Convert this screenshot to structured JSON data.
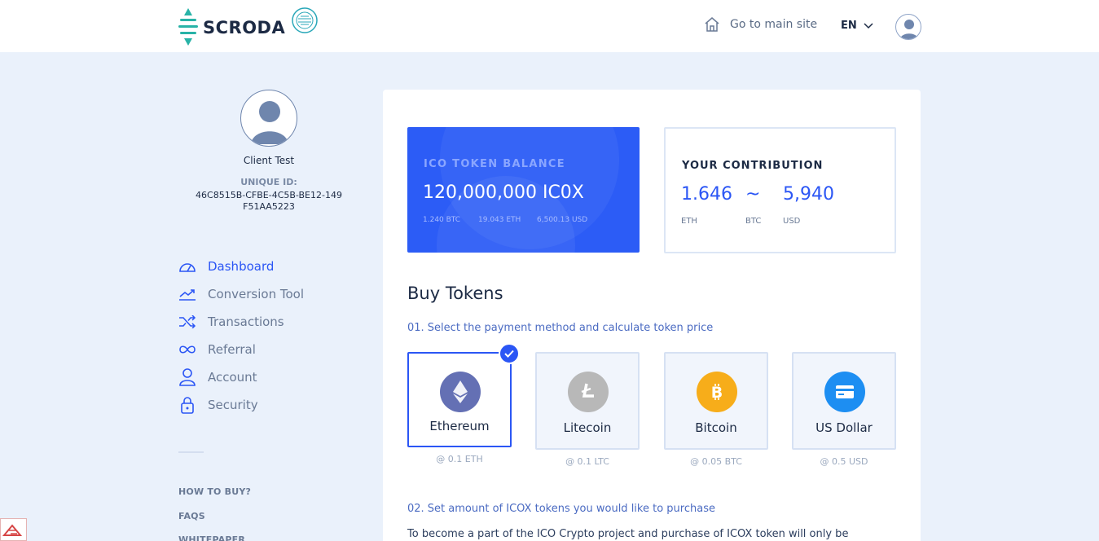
{
  "header": {
    "brand": "SCRODA",
    "home_link": "Go to main site",
    "language": "EN"
  },
  "profile": {
    "name": "Client Test",
    "uid_label": "UNIQUE ID:",
    "uid_value": "46C8515B-CFBE-4C5B-BE12-149F51AA5223"
  },
  "nav": {
    "items": [
      {
        "label": "Dashboard",
        "icon": "dashboard-icon",
        "active": true
      },
      {
        "label": "Conversion Tool",
        "icon": "trend-icon"
      },
      {
        "label": "Transactions",
        "icon": "shuffle-icon"
      },
      {
        "label": "Referral",
        "icon": "infinity-icon"
      },
      {
        "label": "Account",
        "icon": "user-icon"
      },
      {
        "label": "Security",
        "icon": "lock-icon"
      }
    ],
    "links": [
      "HOW TO BUY?",
      "FAQS",
      "WHITEPAPER"
    ]
  },
  "balance": {
    "label": "ICO TOKEN BALANCE",
    "value": "120,000,000 IC0X",
    "btc": "1.240 BTC",
    "eth": "19.043 ETH",
    "usd": "6,500.13 USD"
  },
  "contribution": {
    "label": "YOUR CONTRIBUTION",
    "eth_value": "1.646",
    "btc_value": "~",
    "usd_value": "5,940",
    "eth_unit": "ETH",
    "btc_unit": "BTC",
    "usd_unit": "USD"
  },
  "buy": {
    "title": "Buy Tokens",
    "step1": "01. Select the payment method and calculate token price",
    "step2": "02. Set amount of ICOX tokens you would like to purchase",
    "paragraph": "To become a part of the ICO Crypto project and purchase of ICOX token will only be",
    "methods": [
      {
        "name": "Ethereum",
        "price": "@ 0.1 ETH",
        "color": "#6470b4",
        "selected": true
      },
      {
        "name": "Litecoin",
        "price": "@ 0.1 LTC",
        "color": "#b8b8b8"
      },
      {
        "name": "Bitcoin",
        "price": "@ 0.05 BTC",
        "color": "#f7ad1a"
      },
      {
        "name": "US Dollar",
        "price": "@ 0.5 USD",
        "color": "#1d8ef2"
      }
    ]
  },
  "colors": {
    "accent": "#2b56f5",
    "background": "#eaf1fb"
  }
}
